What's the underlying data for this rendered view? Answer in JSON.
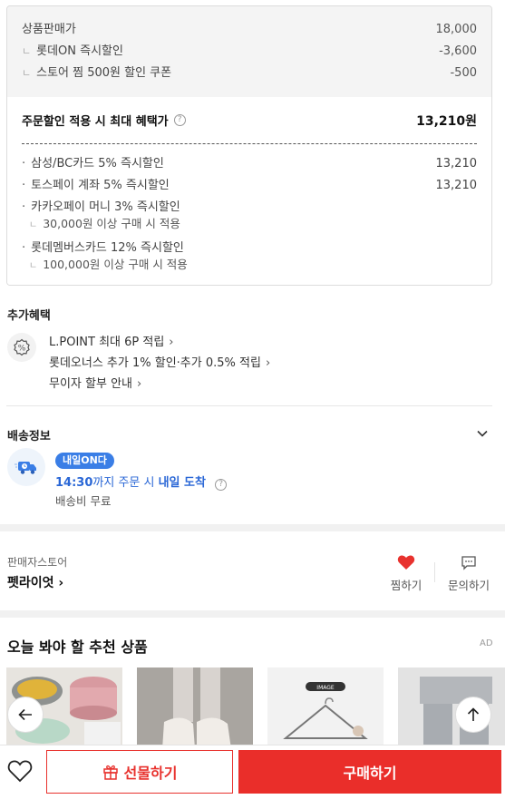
{
  "price_box": {
    "rows": [
      {
        "label": "상품판매가",
        "value": "18,000"
      },
      {
        "label": "롯데ON 즉시할인",
        "value": "-3,600"
      },
      {
        "label": "스토어 찜 500원 할인 쿠폰",
        "value": "-500"
      }
    ],
    "max_benefit": {
      "label": "주문할인 적용 시 최대 혜택가",
      "value": "13,210원",
      "help": "?"
    },
    "cards": [
      {
        "label": "삼성/BC카드 5% 즉시할인",
        "value": "13,210",
        "note": ""
      },
      {
        "label": "토스페이 계좌 5% 즉시할인",
        "value": "13,210",
        "note": ""
      },
      {
        "label": "카카오페이 머니 3% 즉시할인",
        "value": "",
        "note": "30,000원 이상 구매 시 적용"
      },
      {
        "label": "롯데멤버스카드 12% 즉시할인",
        "value": "",
        "note": "100,000원 이상 구매 시 적용"
      }
    ]
  },
  "extra": {
    "title": "추가혜택",
    "icon": "percent-icon",
    "lines": [
      {
        "text": "L.POINT 최대 6P 적립"
      },
      {
        "text": "롯데오너스 추가 1% 할인·추가 0.5% 적립"
      },
      {
        "text": "무이자 할부 안내"
      }
    ]
  },
  "delivery": {
    "title": "배송정보",
    "badge": "내일ON다",
    "time_strong": "14:30",
    "time_rest": "까지 주문 시 ",
    "time_arrive": "내일 도착",
    "fee": "배송비 무료"
  },
  "seller": {
    "label": "판매자스토어",
    "name": "펫라이엇",
    "like_label": "찜하기",
    "inquiry_label": "문의하기"
  },
  "recommend": {
    "title": "오늘 봐야 할 추천 상품",
    "ad": "AD",
    "image_tag": "IMAGE"
  },
  "bottom": {
    "gift_label": "선물하기",
    "buy_label": "구매하기"
  },
  "colors": {
    "accent": "#ea2e2a",
    "blue": "#2a67d6"
  }
}
